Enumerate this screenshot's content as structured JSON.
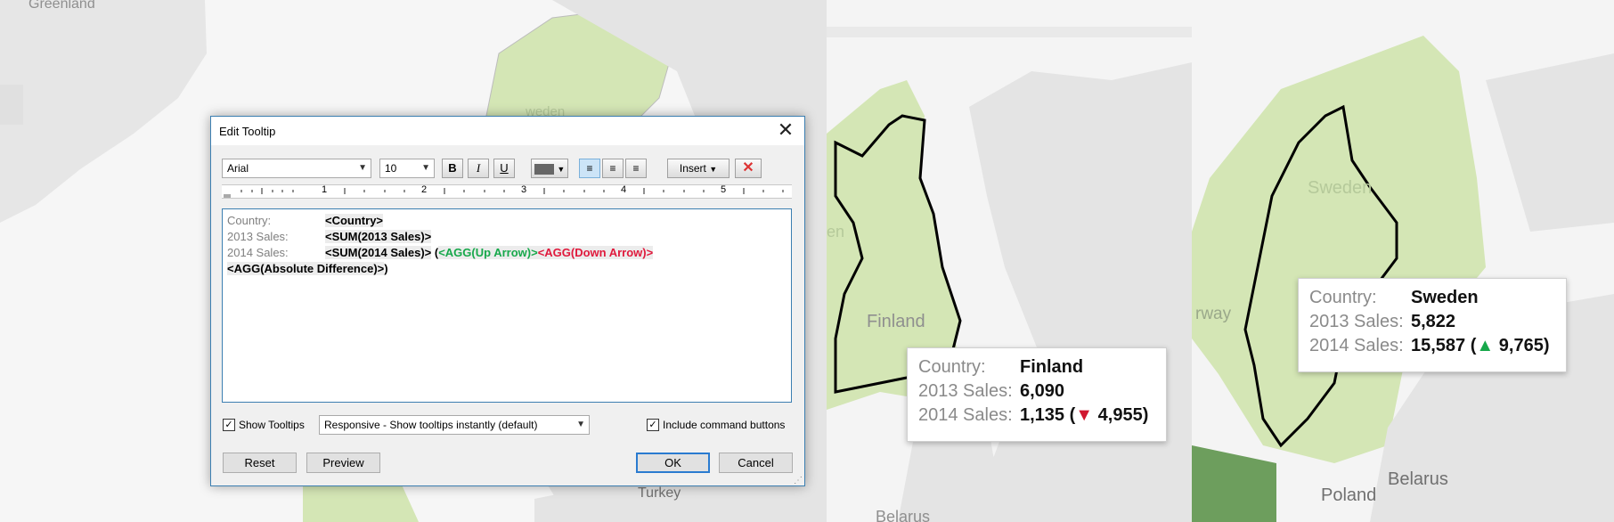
{
  "maps": {
    "panel1_labels": [
      "Greenland",
      "weden",
      "Turkey"
    ],
    "panel2_labels": [
      "Finland",
      "Belarus",
      "en"
    ],
    "panel3_labels": [
      "Sweden",
      "rway",
      "Poland",
      "Belarus"
    ],
    "colors": {
      "land": "#e4e4e4",
      "water": "#f6f6f6",
      "highlight": "#d4e6b5",
      "dark_green": "#6d9e5d",
      "outline": "#000000"
    }
  },
  "dialog": {
    "title": "Edit Tooltip",
    "close_icon": "close-icon",
    "font_family": "Arial",
    "font_size": "10",
    "bold_label": "B",
    "italic_label": "I",
    "underline_label": "U",
    "insert_label": "Insert",
    "ruler_numbers": [
      "1",
      "2",
      "3",
      "4",
      "5"
    ],
    "editor": {
      "line1_label": "Country:",
      "line1_field": "<Country>",
      "line2_label": "2013 Sales:",
      "line2_field": "<SUM(2013 Sales)>",
      "line3_label": "2014 Sales:",
      "line3_field": "<SUM(2014 Sales)>",
      "line3_paren": "(",
      "line3_up": "<AGG(Up Arrow)>",
      "line3_down": "<AGG(Down Arrow)>",
      "line4_field": "<AGG(Absolute Difference)>",
      "line4_paren": ")"
    },
    "show_tooltips_label": "Show Tooltips",
    "show_tooltips_checked": true,
    "tooltip_mode": "Responsive - Show tooltips instantly (default)",
    "include_command_label": "Include command buttons",
    "include_command_checked": true,
    "reset_label": "Reset",
    "preview_label": "Preview",
    "ok_label": "OK",
    "cancel_label": "Cancel"
  },
  "tooltip_finland": {
    "country_label": "Country:",
    "country": "Finland",
    "sales2013_label": "2013 Sales:",
    "sales2013": "6,090",
    "sales2014_label": "2014 Sales:",
    "sales2014": "1,135",
    "open": "(",
    "arrow": "▼",
    "diff": "4,955",
    "close": ")"
  },
  "tooltip_sweden": {
    "country_label": "Country:",
    "country": "Sweden",
    "sales2013_label": "2013 Sales:",
    "sales2013": "5,822",
    "sales2014_label": "2014 Sales:",
    "sales2014": "15,587",
    "open": "(",
    "arrow": "▲",
    "diff": "9,765",
    "close": ")"
  }
}
